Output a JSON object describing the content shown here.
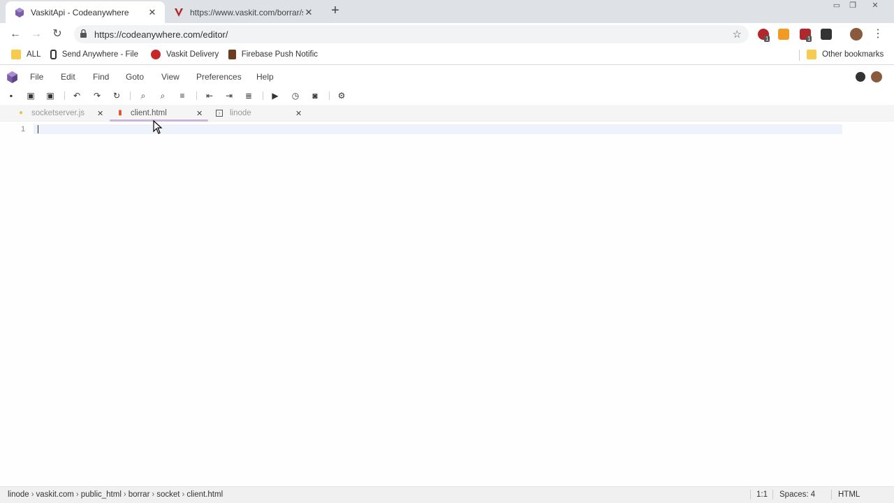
{
  "browser": {
    "tabs": [
      {
        "title": "VaskitApi - Codeanywhere",
        "favicon": "codeanywhere-cube-icon",
        "active": true
      },
      {
        "title": "https://www.vaskit.com/borrar/s",
        "favicon": "vaskit-v-icon",
        "active": false
      }
    ],
    "url": "https://codeanywhere.com/editor/",
    "bookmarks": [
      {
        "label": "ALL",
        "icon": "folder-icon"
      },
      {
        "label": "Send Anywhere - File",
        "icon": "send-anywhere-icon"
      },
      {
        "label": "Vaskit Delivery",
        "icon": "vaskit-delivery-icon"
      },
      {
        "label": "Firebase Push Notific",
        "icon": "firebase-icon"
      }
    ],
    "other_bookmarks": "Other bookmarks",
    "extension_badges": [
      "1",
      "1"
    ]
  },
  "app": {
    "menu": [
      "File",
      "Edit",
      "Find",
      "Goto",
      "View",
      "Preferences",
      "Help"
    ],
    "file_tabs": [
      {
        "label": "socketserver.js",
        "icon": "js-file-icon",
        "active": false
      },
      {
        "label": "client.html",
        "icon": "html-file-icon",
        "active": true
      },
      {
        "label": "linode",
        "icon": "terminal-icon",
        "active": false
      }
    ],
    "editor": {
      "line_number": "1"
    },
    "status": {
      "breadcrumb": [
        "linode",
        "vaskit.com",
        "public_html",
        "borrar",
        "socket",
        "client.html"
      ],
      "cursor_pos": "1:1",
      "indent": "Spaces: 4",
      "language": "HTML"
    }
  },
  "colors": {
    "accent": "#7b5ea7",
    "tab_underline": "#c9b6d8",
    "current_line": "#eef3fb"
  }
}
